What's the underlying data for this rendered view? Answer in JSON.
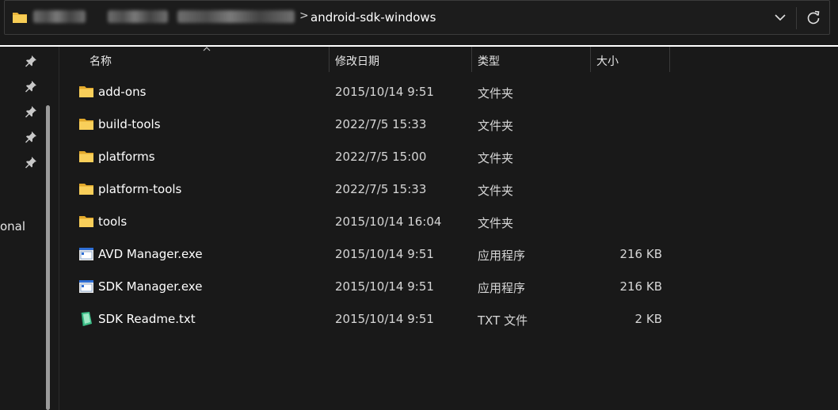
{
  "address_bar": {
    "current_folder": "android-sdk-windows",
    "separator": ">",
    "redacted_crumbs": 3,
    "dropdown_icon": "chevron-down-icon",
    "refresh_icon": "refresh-icon"
  },
  "navigation_pane": {
    "pinned_count": 5,
    "visible_text": "onal"
  },
  "columns": {
    "name": "名称",
    "date": "修改日期",
    "type": "类型",
    "size": "大小"
  },
  "files": [
    {
      "name": "add-ons",
      "date": "2015/10/14 9:51",
      "type": "文件夹",
      "size": "",
      "icon": "folder-icon"
    },
    {
      "name": "build-tools",
      "date": "2022/7/5 15:33",
      "type": "文件夹",
      "size": "",
      "icon": "folder-icon"
    },
    {
      "name": "platforms",
      "date": "2022/7/5 15:00",
      "type": "文件夹",
      "size": "",
      "icon": "folder-icon"
    },
    {
      "name": "platform-tools",
      "date": "2022/7/5 15:33",
      "type": "文件夹",
      "size": "",
      "icon": "folder-icon"
    },
    {
      "name": "tools",
      "date": "2015/10/14 16:04",
      "type": "文件夹",
      "size": "",
      "icon": "folder-icon"
    },
    {
      "name": "AVD Manager.exe",
      "date": "2015/10/14 9:51",
      "type": "应用程序",
      "size": "216 KB",
      "icon": "application-icon"
    },
    {
      "name": "SDK Manager.exe",
      "date": "2015/10/14 9:51",
      "type": "应用程序",
      "size": "216 KB",
      "icon": "application-icon"
    },
    {
      "name": "SDK Readme.txt",
      "date": "2015/10/14 9:51",
      "type": "TXT 文件",
      "size": "2 KB",
      "icon": "text-file-icon"
    }
  ],
  "colors": {
    "background": "#191919",
    "folder": "#f4c542",
    "text": "#ffffff",
    "secondary_text": "#d6d6d6"
  }
}
